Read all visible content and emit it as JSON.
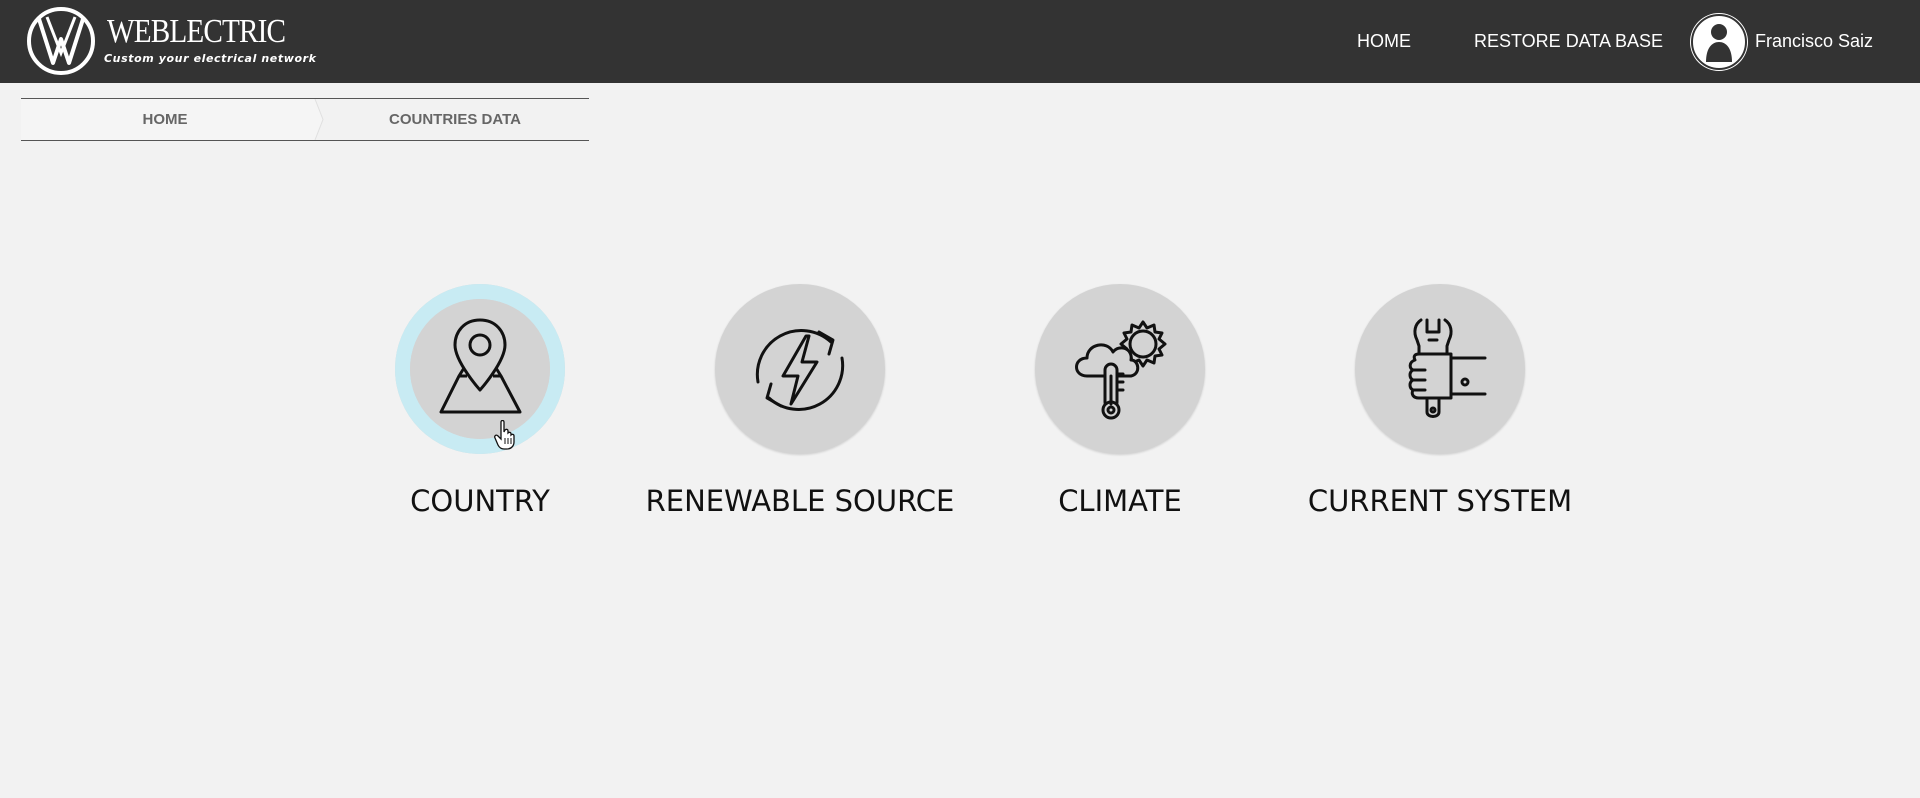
{
  "header": {
    "brand": "WEBLECTRIC",
    "tagline": "Custom your electrical network",
    "nav": [
      {
        "label": "HOME"
      },
      {
        "label": "RESTORE DATA BASE"
      }
    ],
    "user_name": "Francisco Saiz"
  },
  "breadcrumb": {
    "items": [
      {
        "label": "HOME"
      },
      {
        "label": "COUNTRIES DATA"
      }
    ]
  },
  "tiles": [
    {
      "label": "COUNTRY",
      "icon": "map-pin-icon",
      "active": true
    },
    {
      "label": "RENEWABLE SOURCE",
      "icon": "renewable-energy-icon",
      "active": false
    },
    {
      "label": "CLIMATE",
      "icon": "climate-icon",
      "active": false
    },
    {
      "label": "CURRENT SYSTEM",
      "icon": "wrench-hand-icon",
      "active": false
    }
  ],
  "colors": {
    "header_bg": "#333333",
    "page_bg": "#f2f2f2",
    "tile_bg": "#d3d3d3",
    "active_ring": "#c8ebf3"
  }
}
